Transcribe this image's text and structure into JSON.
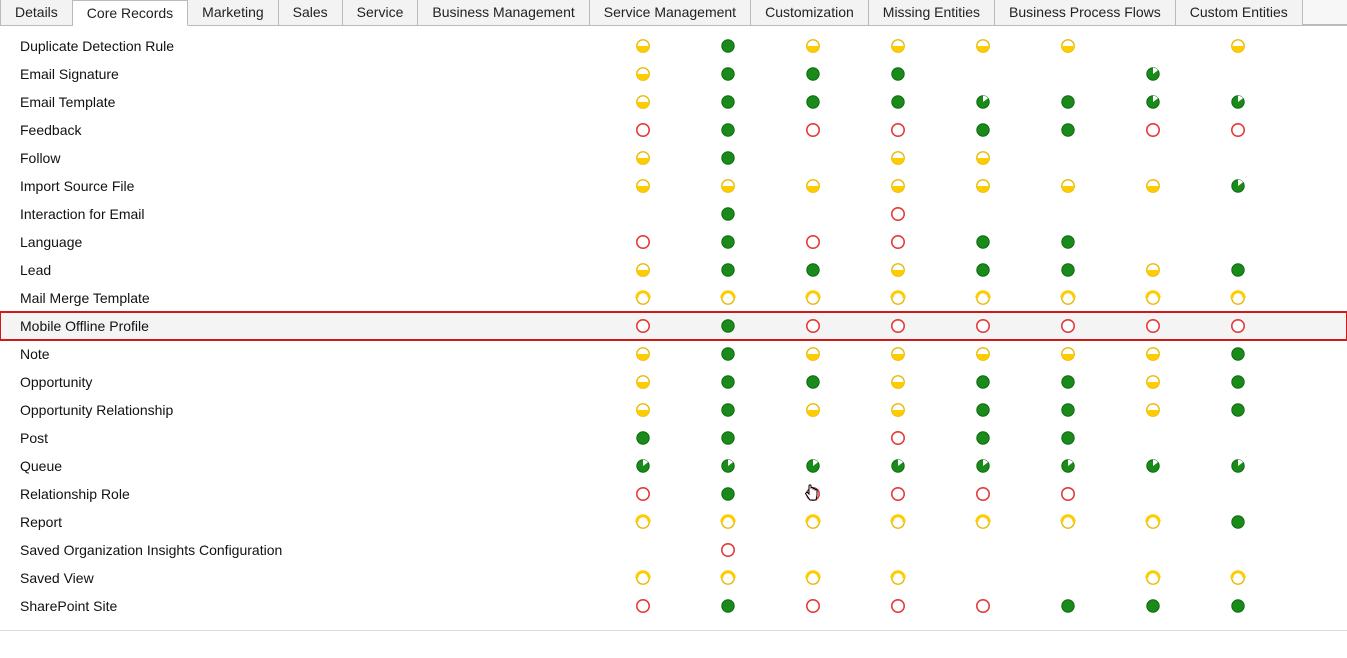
{
  "tabs": [
    {
      "label": "Details",
      "active": false
    },
    {
      "label": "Core Records",
      "active": true
    },
    {
      "label": "Marketing",
      "active": false
    },
    {
      "label": "Sales",
      "active": false
    },
    {
      "label": "Service",
      "active": false
    },
    {
      "label": "Business Management",
      "active": false
    },
    {
      "label": "Service Management",
      "active": false
    },
    {
      "label": "Customization",
      "active": false
    },
    {
      "label": "Missing Entities",
      "active": false
    },
    {
      "label": "Business Process Flows",
      "active": false
    },
    {
      "label": "Custom Entities",
      "active": false
    }
  ],
  "icon_legend": {
    "gf": "green-full",
    "yh": "yellow-half-bottom",
    "yr": "yellow-ring-partial",
    "re": "red-empty",
    "gq": "green-quarter-top",
    "": "blank"
  },
  "rows": [
    {
      "label": "Duplicate Detection Rule",
      "highlight": false,
      "cells": [
        "yh",
        "gf",
        "yh",
        "yh",
        "yh",
        "yh",
        "",
        "yh"
      ]
    },
    {
      "label": "Email Signature",
      "highlight": false,
      "cells": [
        "yh",
        "gf",
        "gf",
        "gf",
        "",
        "",
        "gq",
        ""
      ]
    },
    {
      "label": "Email Template",
      "highlight": false,
      "cells": [
        "yh",
        "gf",
        "gf",
        "gf",
        "gq",
        "gf",
        "gq",
        "gq"
      ]
    },
    {
      "label": "Feedback",
      "highlight": false,
      "cells": [
        "re",
        "gf",
        "re",
        "re",
        "gf",
        "gf",
        "re",
        "re"
      ]
    },
    {
      "label": "Follow",
      "highlight": false,
      "cells": [
        "yh",
        "gf",
        "",
        "yh",
        "yh",
        "",
        "",
        ""
      ]
    },
    {
      "label": "Import Source File",
      "highlight": false,
      "cells": [
        "yh",
        "yh",
        "yh",
        "yh",
        "yh",
        "yh",
        "yh",
        "gq"
      ]
    },
    {
      "label": "Interaction for Email",
      "highlight": false,
      "cells": [
        "",
        "gf",
        "",
        "re",
        "",
        "",
        "",
        ""
      ]
    },
    {
      "label": "Language",
      "highlight": false,
      "cells": [
        "re",
        "gf",
        "re",
        "re",
        "gf",
        "gf",
        "",
        ""
      ]
    },
    {
      "label": "Lead",
      "highlight": false,
      "cells": [
        "yh",
        "gf",
        "gf",
        "yh",
        "gf",
        "gf",
        "yh",
        "gf"
      ]
    },
    {
      "label": "Mail Merge Template",
      "highlight": false,
      "cells": [
        "yr",
        "yr",
        "yr",
        "yr",
        "yr",
        "yr",
        "yr",
        "yr"
      ]
    },
    {
      "label": "Mobile Offline Profile",
      "highlight": true,
      "cells": [
        "re",
        "gf",
        "re",
        "re",
        "re",
        "re",
        "re",
        "re"
      ]
    },
    {
      "label": "Note",
      "highlight": false,
      "cells": [
        "yh",
        "gf",
        "yh",
        "yh",
        "yh",
        "yh",
        "yh",
        "gf"
      ]
    },
    {
      "label": "Opportunity",
      "highlight": false,
      "cells": [
        "yh",
        "gf",
        "gf",
        "yh",
        "gf",
        "gf",
        "yh",
        "gf"
      ]
    },
    {
      "label": "Opportunity Relationship",
      "highlight": false,
      "cells": [
        "yh",
        "gf",
        "yh",
        "yh",
        "gf",
        "gf",
        "yh",
        "gf"
      ]
    },
    {
      "label": "Post",
      "highlight": false,
      "cells": [
        "gf",
        "gf",
        "",
        "re",
        "gf",
        "gf",
        "",
        ""
      ]
    },
    {
      "label": "Queue",
      "highlight": false,
      "cells": [
        "gq",
        "gq",
        "gq",
        "gq",
        "gq",
        "gq",
        "gq",
        "gq"
      ]
    },
    {
      "label": "Relationship Role",
      "highlight": false,
      "cells": [
        "re",
        "gf",
        "re",
        "re",
        "re",
        "re",
        "",
        ""
      ],
      "cursor": true
    },
    {
      "label": "Report",
      "highlight": false,
      "cells": [
        "yr",
        "yr",
        "yr",
        "yr",
        "yr",
        "yr",
        "yr",
        "gf"
      ]
    },
    {
      "label": "Saved Organization Insights Configuration",
      "highlight": false,
      "cells": [
        "",
        "re",
        "",
        "",
        "",
        "",
        "",
        ""
      ]
    },
    {
      "label": "Saved View",
      "highlight": false,
      "cells": [
        "yr",
        "yr",
        "yr",
        "yr",
        "",
        "",
        "yr",
        "yr"
      ]
    },
    {
      "label": "SharePoint Site",
      "highlight": false,
      "cells": [
        "re",
        "gf",
        "re",
        "re",
        "re",
        "gf",
        "gf",
        "gf"
      ]
    }
  ]
}
